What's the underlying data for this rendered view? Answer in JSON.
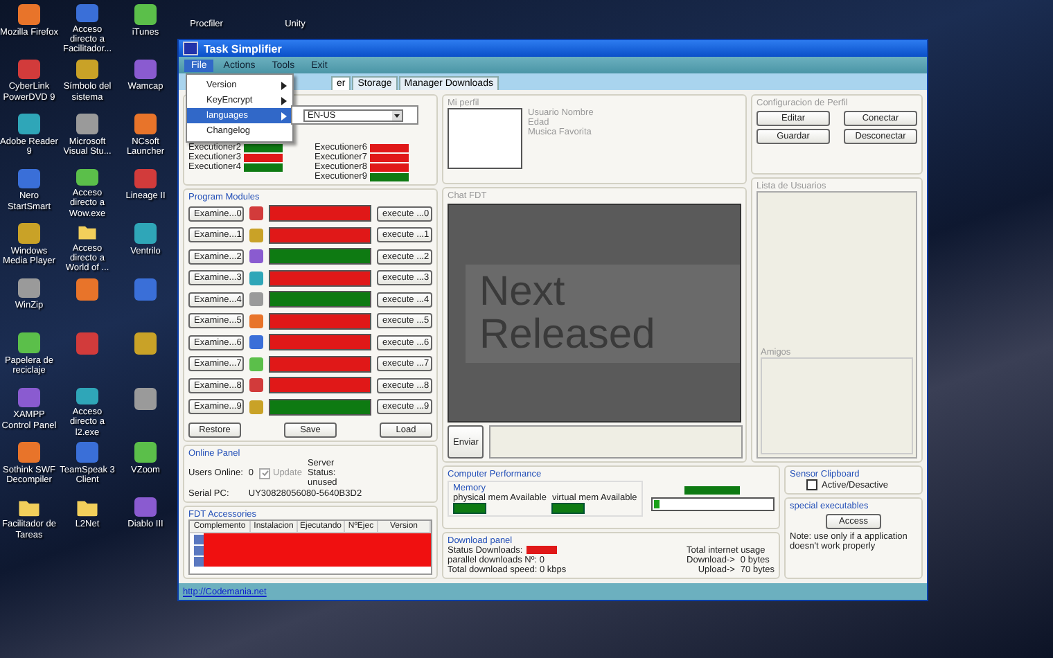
{
  "desktop": {
    "icons": [
      {
        "kind": "app",
        "label": "Mozilla Firefox"
      },
      {
        "kind": "app",
        "label": "Acceso directo a Facilitador..."
      },
      {
        "kind": "app",
        "label": "iTunes"
      },
      {
        "kind": "app",
        "label": "CyberLink PowerDVD 9"
      },
      {
        "kind": "app",
        "label": "Símbolo del sistema"
      },
      {
        "kind": "app",
        "label": "Wamcap"
      },
      {
        "kind": "app",
        "label": "Adobe Reader 9"
      },
      {
        "kind": "app",
        "label": "Microsoft Visual Stu..."
      },
      {
        "kind": "app",
        "label": "NCsoft Launcher"
      },
      {
        "kind": "app",
        "label": "Nero StartSmart"
      },
      {
        "kind": "app",
        "label": "Acceso directo a Wow.exe"
      },
      {
        "kind": "app",
        "label": "Lineage II"
      },
      {
        "kind": "app",
        "label": "Windows Media Player"
      },
      {
        "kind": "folder",
        "label": "Acceso directo a World of ..."
      },
      {
        "kind": "app",
        "label": "Ventrilo"
      },
      {
        "kind": "app",
        "label": "WinZip"
      },
      {
        "kind": "app"
      },
      {
        "kind": "app"
      },
      {
        "kind": "app",
        "label": "Papelera de reciclaje"
      },
      {
        "kind": "app"
      },
      {
        "kind": "app"
      },
      {
        "kind": "app",
        "label": "XAMPP Control Panel"
      },
      {
        "kind": "app",
        "label": "Acceso directo a l2.exe"
      },
      {
        "kind": "app"
      },
      {
        "kind": "app",
        "label": "Sothink SWF Decompiler"
      },
      {
        "kind": "app",
        "label": "TeamSpeak 3 Client"
      },
      {
        "kind": "app",
        "label": "VZoom"
      },
      {
        "kind": "folder",
        "label": "Facilitador de Tareas"
      },
      {
        "kind": "folder",
        "label": "L2Net"
      },
      {
        "kind": "app",
        "label": "Diablo III"
      }
    ],
    "top_icons": [
      {
        "label": "Procfiler"
      },
      {
        "label": "Unity"
      }
    ]
  },
  "window": {
    "title": "Task Simplifier",
    "menu": [
      {
        "label": "File",
        "selected": true
      },
      {
        "label": "Actions",
        "selected": false
      },
      {
        "label": "Tools",
        "selected": false
      },
      {
        "label": "Exit",
        "selected": false
      }
    ],
    "file_menu": [
      {
        "label": "Version",
        "submenu": true,
        "selected": false
      },
      {
        "label": "KeyEncrypt",
        "submenu": true,
        "selected": false
      },
      {
        "label": "languages",
        "submenu": true,
        "selected": true
      },
      {
        "label": "Changelog",
        "submenu": false,
        "selected": false
      }
    ],
    "language_combo": {
      "value": "EN-US"
    },
    "tabs": [
      {
        "label": "er",
        "selected": true
      },
      {
        "label": "Storage",
        "selected": false
      },
      {
        "label": "Manager Downloads",
        "selected": false
      }
    ],
    "link": "http://Codemania.net"
  },
  "executioners": {
    "left": [
      {
        "label": "Executioner2",
        "color": "#0e7a12"
      },
      {
        "label": "Executioner3",
        "color": "#e01818"
      },
      {
        "label": "Executioner4",
        "color": "#0e7a12"
      }
    ],
    "right": [
      {
        "label": "Executioner6",
        "color": "#e01818"
      },
      {
        "label": "Executioner7",
        "color": "#e01818"
      },
      {
        "label": "Executioner8",
        "color": "#e01818"
      },
      {
        "label": "Executioner9",
        "color": "#0e7a12"
      }
    ]
  },
  "program_modules": {
    "title": "Program Modules",
    "rows": [
      {
        "examine": "Examine...0",
        "execute": "execute ...0",
        "color": "#e01818"
      },
      {
        "examine": "Examine...1",
        "execute": "execute ...1",
        "color": "#e01818"
      },
      {
        "examine": "Examine...2",
        "execute": "execute ...2",
        "color": "#0e7a12"
      },
      {
        "examine": "Examine...3",
        "execute": "execute ...3",
        "color": "#e01818"
      },
      {
        "examine": "Examine...4",
        "execute": "execute ...4",
        "color": "#0e7a12"
      },
      {
        "examine": "Examine...5",
        "execute": "execute ...5",
        "color": "#e01818"
      },
      {
        "examine": "Examine...6",
        "execute": "execute ...6",
        "color": "#e01818"
      },
      {
        "examine": "Examine...7",
        "execute": "execute ...7",
        "color": "#e01818"
      },
      {
        "examine": "Examine...8",
        "execute": "execute ...8",
        "color": "#e01818"
      },
      {
        "examine": "Examine...9",
        "execute": "execute ...9",
        "color": "#0e7a12"
      }
    ],
    "buttons": [
      "Restore",
      "Save",
      "Load"
    ]
  },
  "online_panel": {
    "title": "Online Panel",
    "users_label": "Users Online:",
    "users_value": "0",
    "update": {
      "label": "Update",
      "checked": true,
      "disabled": true
    },
    "server_status": "Server Status: unused",
    "serial_label": "Serial PC:",
    "serial_value": "UY30828056080-5640B3D2"
  },
  "fdt_accessories": {
    "title": "FDT Accessories",
    "columns": [
      "Complemento",
      "Instalacion",
      "Ejecutando",
      "NºEjec",
      "Version"
    ],
    "rows": [
      {
        "color": "#f01010"
      },
      {
        "color": "#f01010"
      },
      {
        "color": "#f01010"
      }
    ]
  },
  "profile": {
    "title": "Mi perfil",
    "fields": [
      "Usuario Nombre",
      "Edad",
      "Musica Favorita"
    ]
  },
  "chat": {
    "title": "Chat FDT",
    "message": "Next Released",
    "send_button": "Enviar"
  },
  "profile_config": {
    "title": "Configuracion de Perfil",
    "buttons": [
      "Editar",
      "Conectar",
      "Guardar",
      "Desconectar"
    ]
  },
  "user_list": {
    "title": "Lista de Usuarios",
    "friends_title": "Amigos"
  },
  "performance": {
    "title": "Computer Performance",
    "memory_title": "Memory",
    "physical": "physical mem Available",
    "virtual": "virtual mem Available",
    "usage_bar": {
      "level": 0.05
    }
  },
  "download_panel": {
    "title": "Download panel",
    "status_label": "Status Downloads:",
    "parallel": "parallel downloads Nº: 0",
    "speed": "Total download speed: 0 kbps",
    "usage_title": "Total internet usage",
    "download_label": "Download->",
    "download_value": "0 bytes",
    "upload_label": "Upload->",
    "upload_value": "70 bytes"
  },
  "sensor_clipboard": {
    "title": "Sensor Clipboard",
    "checkbox": {
      "label": "Active/Desactive",
      "checked": false
    }
  },
  "special_executables": {
    "title": "special executables",
    "button": "Access",
    "note": "Note: use only if a application doesn't work properly"
  }
}
